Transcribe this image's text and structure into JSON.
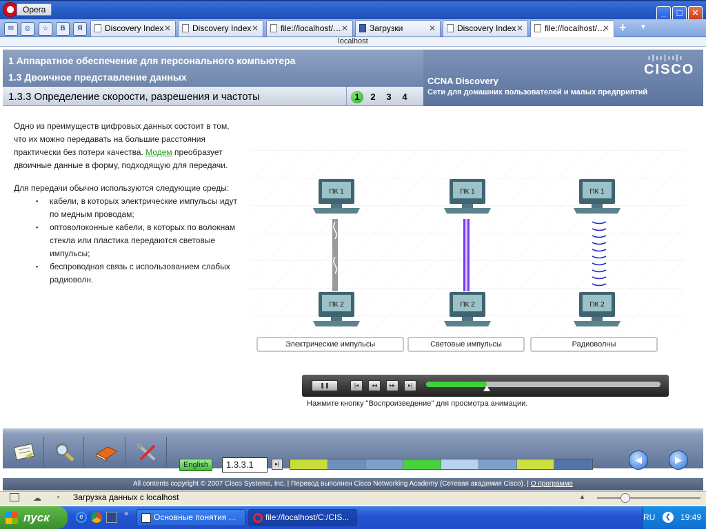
{
  "window": {
    "app_label": "Opera"
  },
  "tabs": [
    {
      "label": "Discovery Index"
    },
    {
      "label": "Discovery Index"
    },
    {
      "label": "file://localhost/…"
    },
    {
      "label": "Загрузки"
    },
    {
      "label": "Discovery Index"
    },
    {
      "label": "file://localhost/…"
    }
  ],
  "quick_icons": [
    "mail-icon",
    "opera-icon",
    "star-icon",
    "vk-icon",
    "yandex-icon"
  ],
  "quick_icon_labels": [
    "✉",
    "◎",
    "☆",
    "В",
    "Я"
  ],
  "address": "localhost",
  "course": {
    "chapter": "1 Аппаратное обеспечение для персонального компьютера",
    "section": "1.3 Двоичное представление данных",
    "subsection": "1.3.3 Определение скорости, разрешения и частоты",
    "pages": [
      "1",
      "2",
      "3",
      "4"
    ],
    "active_page": 0,
    "brand": "CISCO",
    "program": "CCNA Discovery",
    "program_sub": "Сети для домашних пользователей и малых предприятий"
  },
  "body": {
    "p1_a": "Одно из преимуществ цифровых данных состоит в том, что их можно передавать на большие расстояния практически без потери качества. ",
    "p1_link": "Модем",
    "p1_b": " преобразует двоичные данные в форму, подходящую для передачи.",
    "p2": "Для передачи обычно используются следующие среды:",
    "bullets": [
      "кабели, в которых электрические импульсы идут по медным проводам;",
      "оптоволоконные кабели, в которых по волокнам стекла или пластика передаются световые импульсы;",
      "беспроводная связь с использованием слабых радиоволн."
    ]
  },
  "diagram": {
    "pc_top": "ПК 1",
    "pc_bottom": "ПК 2",
    "labels": [
      "Электрические импульсы",
      "Световые импульсы",
      "Радиоволны"
    ]
  },
  "player": {
    "progress": 0.26,
    "hint": "Нажмите кнопку \"Воспроизведение\" для просмотра анимации."
  },
  "toolbar": {
    "language": "English",
    "section_id": "1.3.3.1",
    "progress_colors": [
      "#c9dd3a",
      "#6f8fbd",
      "#7ea0c8",
      "#48d13d",
      "#b7d3ee",
      "#7ea0c8",
      "#cbe03e",
      "#5473a8"
    ]
  },
  "copyright": {
    "text": "All contents copyright © 2007 Cisco Systems, Inc. | Перевод выполнен Cisco Networking Academy (Сетевая академия Cisco). | ",
    "link": "О программе"
  },
  "statusbar": {
    "text": "Загрузка данных с localhost"
  },
  "taskbar": {
    "start": "пуск",
    "tasks": [
      "Основные понятия ...",
      "file://localhost/C:/CIS..."
    ],
    "lang": "RU",
    "time": "19:49"
  }
}
